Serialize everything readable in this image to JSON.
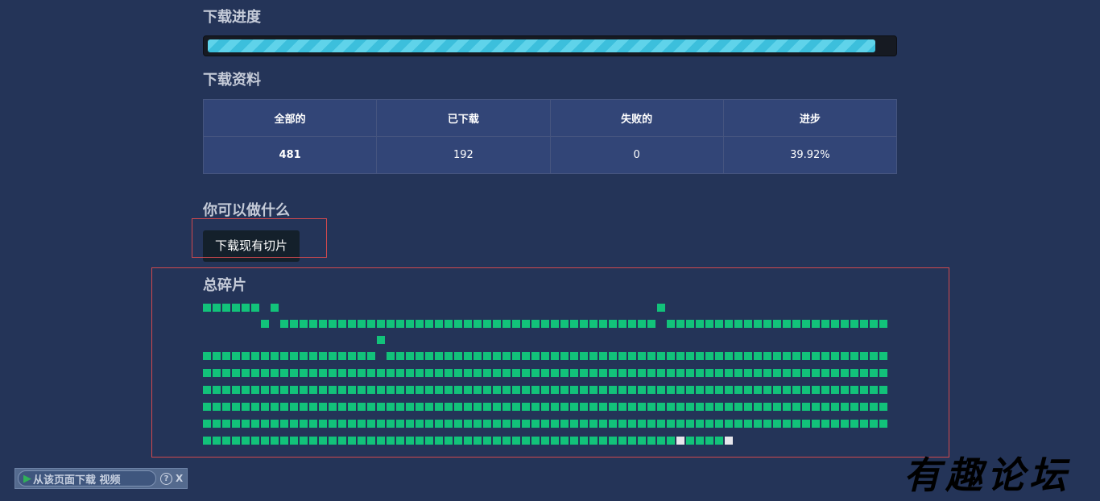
{
  "progress_section": {
    "title": "下载进度",
    "progress_fraction": 0.9748
  },
  "stats_section": {
    "title": "下载资料",
    "headers": [
      "全部的",
      "已下载",
      "失败的",
      "进步"
    ],
    "values": [
      "481",
      "192",
      "0",
      "39.92%"
    ]
  },
  "actions_section": {
    "title": "你可以做什么",
    "download_button": "下载现有切片"
  },
  "fragments_section": {
    "title": "总碎片",
    "colors": {
      "done": "#12c27a",
      "pending": "#e6e6ec"
    }
  },
  "download_toolbar": {
    "label": "从该页面下载 视频",
    "help": "?",
    "close": "X"
  },
  "watermark": "有趣论坛"
}
